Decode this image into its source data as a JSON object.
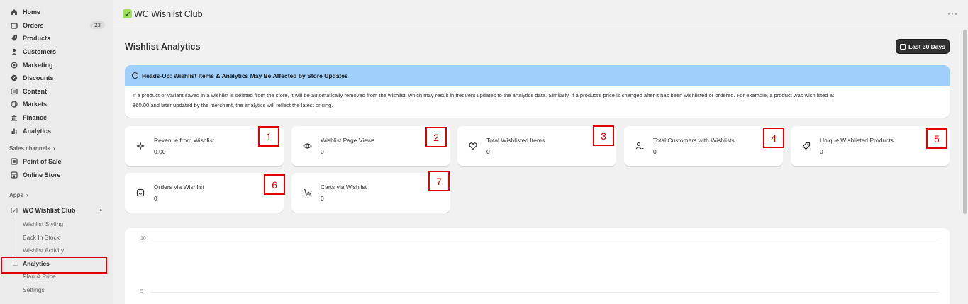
{
  "sidebar": {
    "main_items": [
      {
        "label": "Home",
        "icon": "home-icon"
      },
      {
        "label": "Orders",
        "icon": "orders-icon",
        "badge": "23"
      },
      {
        "label": "Products",
        "icon": "tag-icon"
      },
      {
        "label": "Customers",
        "icon": "person-icon"
      },
      {
        "label": "Marketing",
        "icon": "target-icon"
      },
      {
        "label": "Discounts",
        "icon": "discount-icon"
      },
      {
        "label": "Content",
        "icon": "content-icon"
      },
      {
        "label": "Markets",
        "icon": "globe-icon"
      },
      {
        "label": "Finance",
        "icon": "bank-icon"
      },
      {
        "label": "Analytics",
        "icon": "chart-bar-icon"
      }
    ],
    "sales_channels_label": "Sales channels",
    "channels": [
      {
        "label": "Point of Sale"
      },
      {
        "label": "Online Store"
      }
    ],
    "apps_label": "Apps",
    "app": {
      "label": "WC Wishlist Club",
      "sub_items": [
        "Wishlist Styling",
        "Back In Stock",
        "Wishlist Activity",
        "Analytics",
        "Plan & Price",
        "Settings"
      ]
    }
  },
  "topbar": {
    "app_title": "WC Wishlist Club",
    "more": "···"
  },
  "page": {
    "title": "Wishlist Analytics",
    "date_range": "Last 30 Days"
  },
  "banner": {
    "title": "Heads-Up: Wishlist Items & Analytics May Be Affected by Store Updates",
    "line1": "If a product or variant saved in a wishlist is deleted from the store, it will be automatically removed from the wishlist, which may result in frequent updates to the analytics data. Similarly, if a product's price is changed after it has been wishlisted or ordered. For example, a product was wishlisted at",
    "line2": "$60.00 and later updated by the merchant, the analytics will reflect the latest pricing."
  },
  "metrics": [
    {
      "label": "Revenue from Wishlist",
      "value": "0.00",
      "icon": "sparkle-icon",
      "marker": "1"
    },
    {
      "label": "Wishlist Page Views",
      "value": "0",
      "icon": "eye-icon",
      "marker": "2"
    },
    {
      "label": "Total Wishlisted Items",
      "value": "0",
      "icon": "heart-icon",
      "marker": "3"
    },
    {
      "label": "Total Customers with Wishlists",
      "value": "0",
      "icon": "customer-list-icon",
      "marker": "4"
    },
    {
      "label": "Unique Wishlisted Products",
      "value": "0",
      "icon": "tag-icon",
      "marker": "5"
    },
    {
      "label": "Orders via Wishlist",
      "value": "0",
      "icon": "inbox-icon",
      "marker": "6"
    },
    {
      "label": "Carts via Wishlist",
      "value": "0",
      "icon": "cart-icon",
      "marker": "7"
    }
  ],
  "chart_data": {
    "type": "line",
    "yticks": [
      "10",
      "5"
    ],
    "ylim": [
      0,
      10
    ],
    "grid": true
  },
  "colors": {
    "accent_red": "#e10000",
    "banner_blue": "#9fd0fb",
    "app_green": "#9ee15f"
  }
}
